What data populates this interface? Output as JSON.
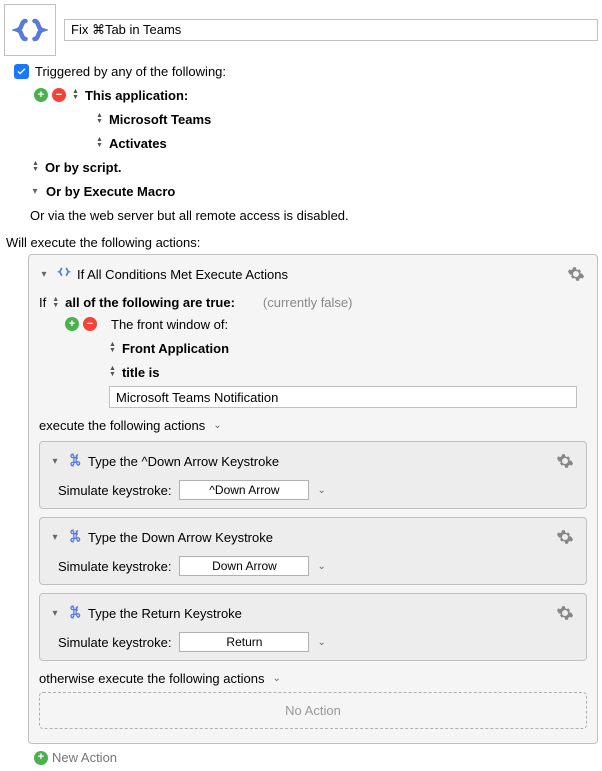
{
  "header": {
    "macro_name": "Fix ⌘Tab in Teams"
  },
  "triggers": {
    "label": "Triggered by any of the following:",
    "this_application": "This application:",
    "app_name": "Microsoft Teams",
    "activates": "Activates",
    "or_script": "Or by script.",
    "or_execute_macro": "Or by Execute Macro",
    "web_server_note": "Or via the web server but all remote access is disabled."
  },
  "actions_heading": "Will execute the following actions:",
  "if_action": {
    "title": "If All Conditions Met Execute Actions",
    "if_label": "If",
    "all_true": "all of the following are true:",
    "currently": "(currently false)",
    "front_window_of": "The front window of:",
    "front_application": "Front Application",
    "title_is": "title is",
    "title_value": "Microsoft Teams Notification",
    "execute_label": "execute the following actions",
    "otherwise_label": "otherwise execute the following actions",
    "no_action": "No Action"
  },
  "keystroke_actions": [
    {
      "title": "Type the ^Down Arrow Keystroke",
      "label": "Simulate keystroke:",
      "value": "^Down Arrow"
    },
    {
      "title": "Type the Down Arrow Keystroke",
      "label": "Simulate keystroke:",
      "value": "Down Arrow"
    },
    {
      "title": "Type the Return Keystroke",
      "label": "Simulate keystroke:",
      "value": "Return"
    }
  ],
  "new_action": "New Action"
}
